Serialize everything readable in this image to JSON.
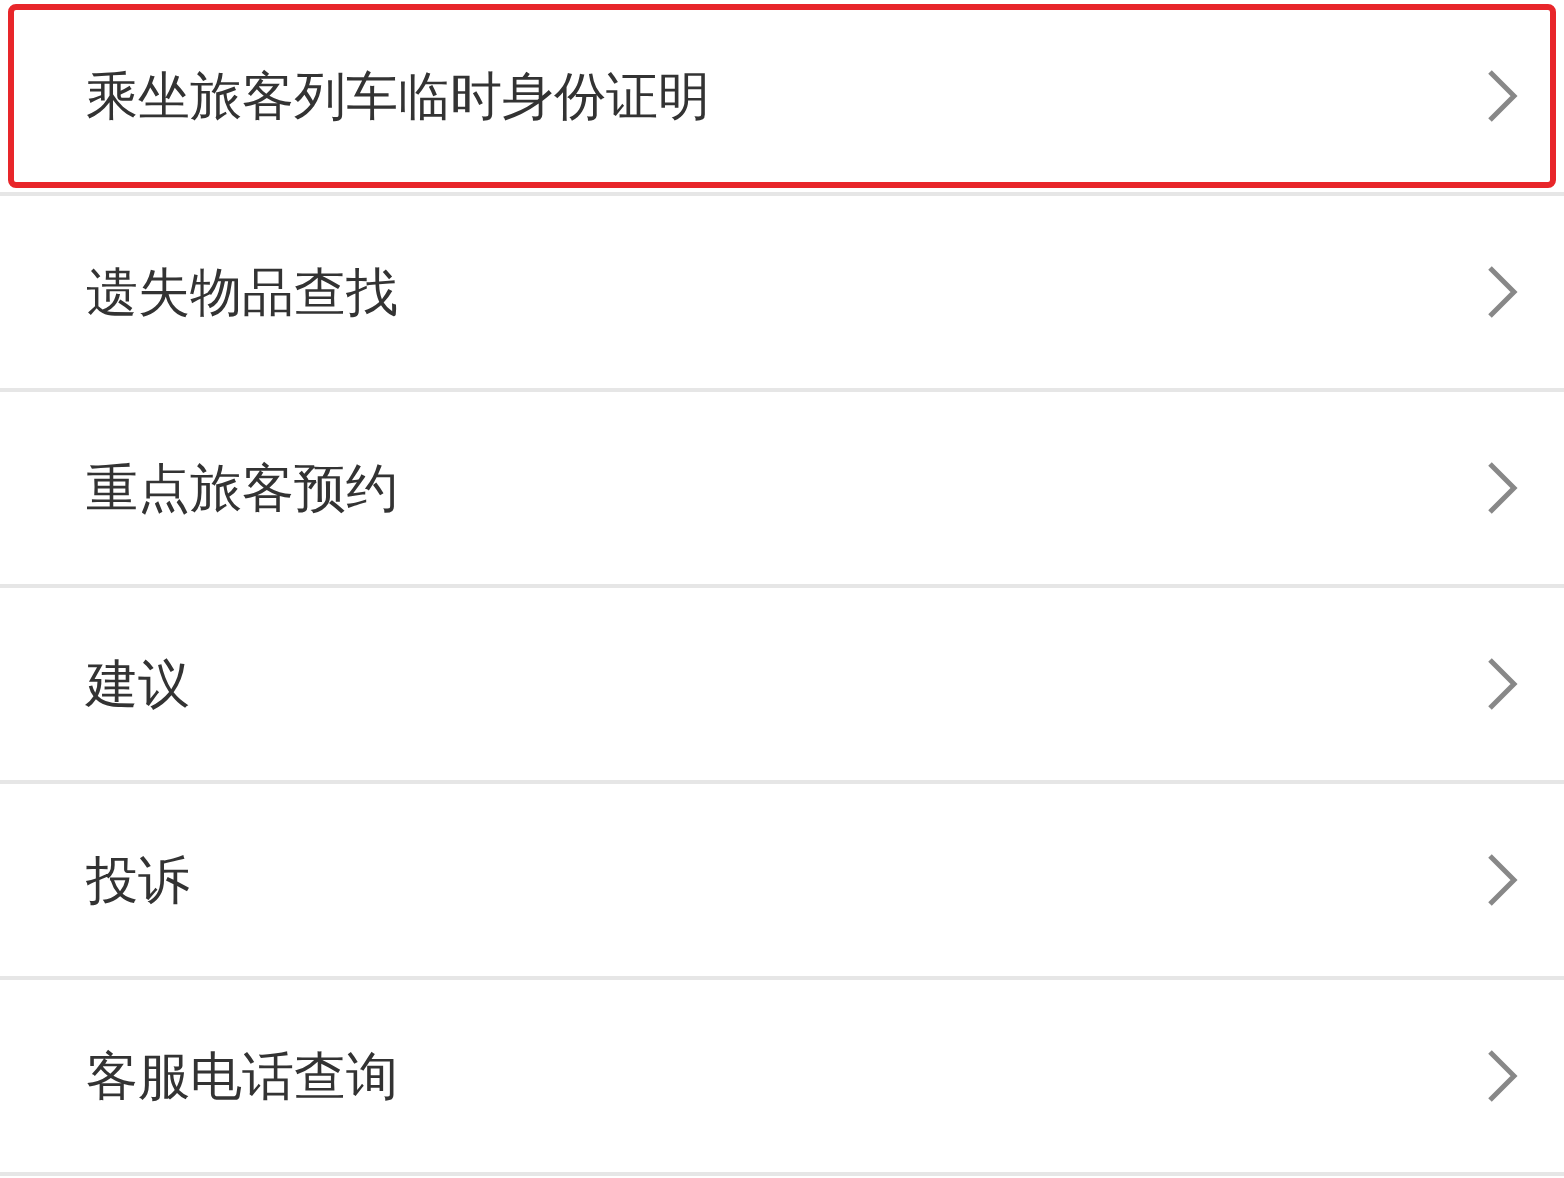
{
  "menu_items": [
    {
      "label": "乘坐旅客列车临时身份证明",
      "highlighted": true
    },
    {
      "label": "遗失物品查找",
      "highlighted": false
    },
    {
      "label": "重点旅客预约",
      "highlighted": false
    },
    {
      "label": "建议",
      "highlighted": false
    },
    {
      "label": "投诉",
      "highlighted": false
    },
    {
      "label": "客服电话查询",
      "highlighted": false
    }
  ]
}
